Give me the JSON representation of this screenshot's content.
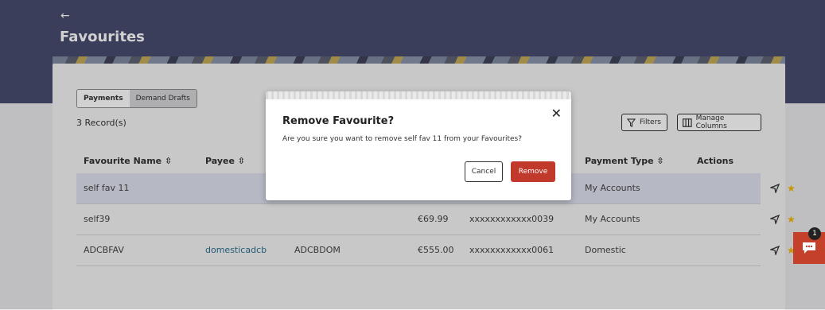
{
  "header": {
    "back_icon": "←",
    "title": "Favourites"
  },
  "tabs": [
    {
      "label": "Payments",
      "active": true
    },
    {
      "label": "Demand Drafts",
      "active": false
    }
  ],
  "records_count": "3 Record(s)",
  "toolbar": {
    "filters_label": "Filters",
    "manage_columns_label": "Manage Columns"
  },
  "table": {
    "columns": [
      "Favourite Name",
      "Payee",
      "",
      "",
      "",
      "Payment Type",
      "Actions"
    ],
    "sort_icon": "⇳",
    "rows": [
      {
        "name": "self fav 11",
        "payee": "",
        "bank": "",
        "amount": "",
        "account": "",
        "payment_type": "My Accounts"
      },
      {
        "name": "self39",
        "payee": "",
        "bank": "",
        "amount": "€69.99",
        "account": "xxxxxxxxxxxx0039",
        "payment_type": "My Accounts"
      },
      {
        "name": "ADCBFAV",
        "payee": "domesticadcb",
        "bank": "ADCBDOM",
        "amount": "€555.00",
        "account": "xxxxxxxxxxxx0061",
        "payment_type": "Domestic"
      }
    ]
  },
  "modal": {
    "title": "Remove Favourite?",
    "message": "Are you sure you want to remove self fav 11 from your Favourites?",
    "close_icon": "✕",
    "cancel_label": "Cancel",
    "remove_label": "Remove"
  },
  "chat": {
    "badge_count": "1"
  },
  "colors": {
    "header_bg": "#474c6e",
    "accent_red": "#c0392b",
    "star": "#f2b705"
  }
}
